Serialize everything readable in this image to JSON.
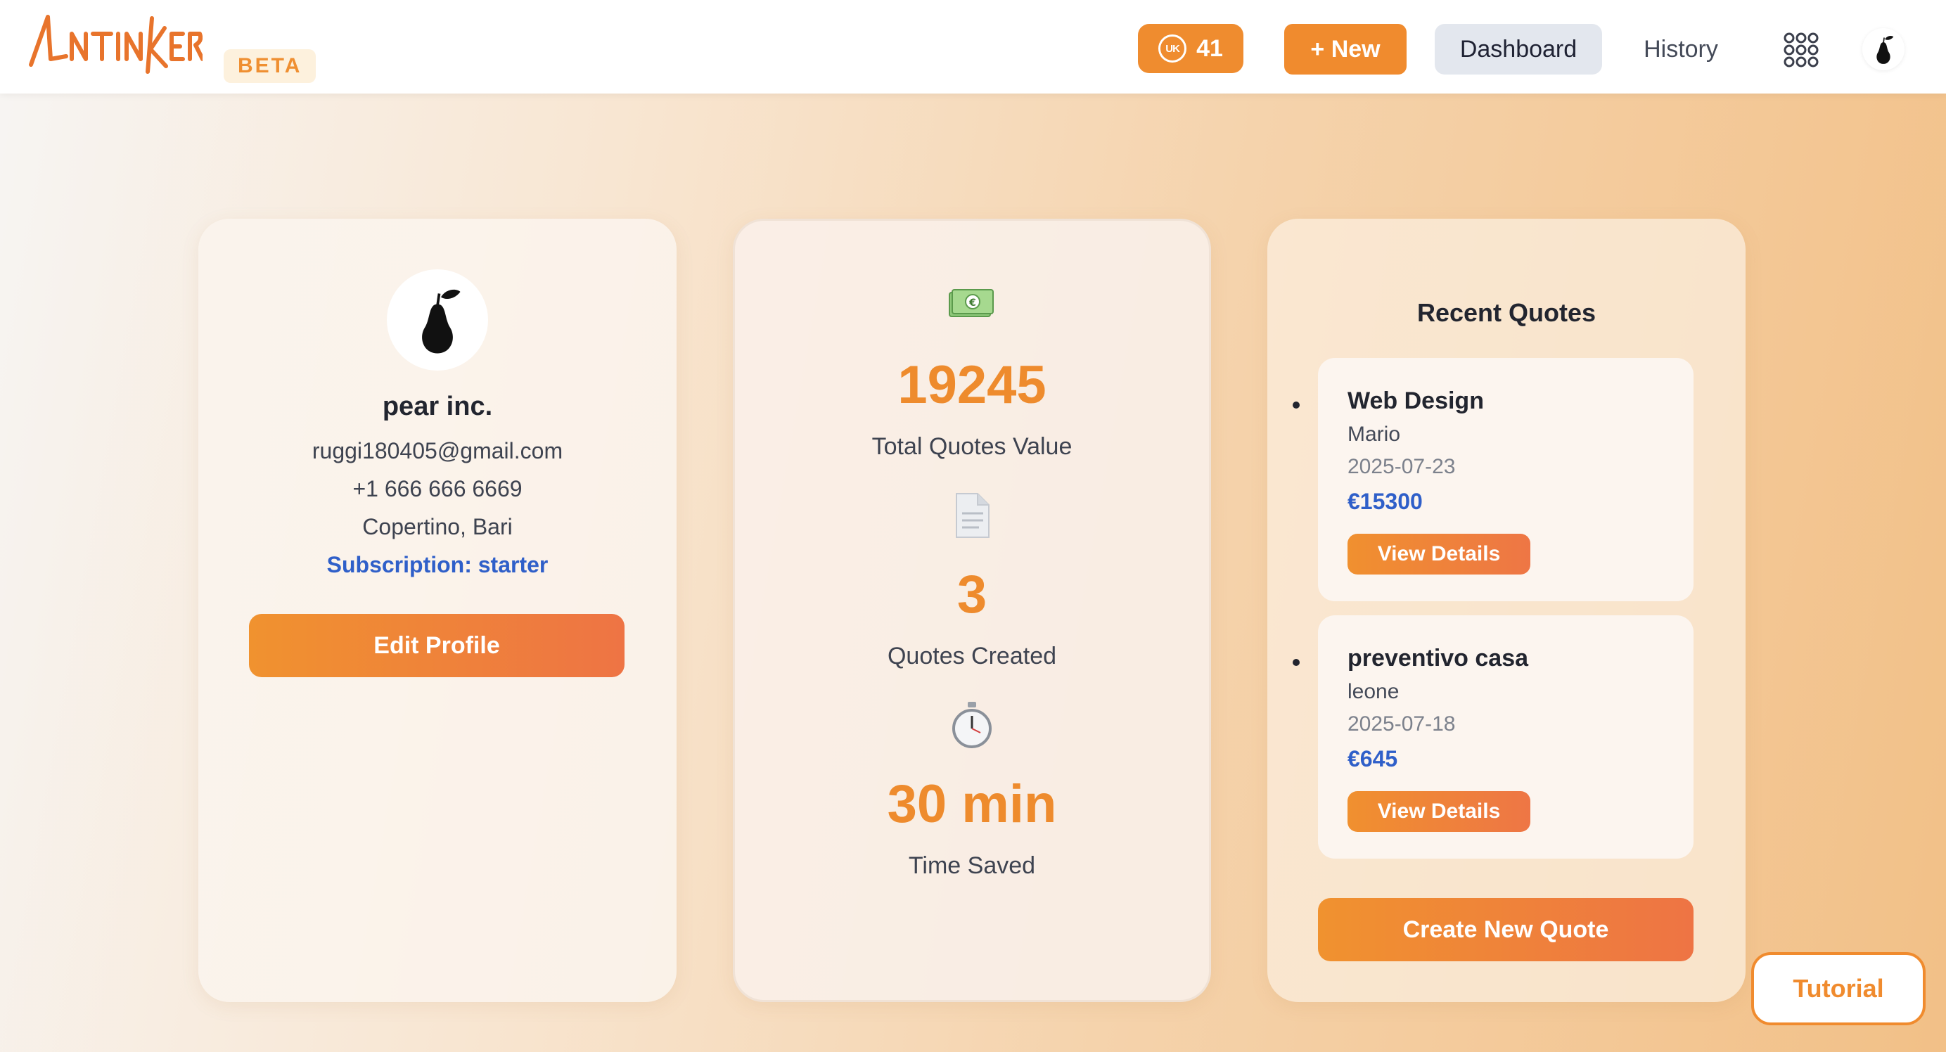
{
  "header": {
    "logo_text": "UNTINKER",
    "beta_label": "BETA",
    "credits": {
      "icon": "coin-icon",
      "icon_text": "UK",
      "value": "41"
    },
    "new_button": "+ New",
    "nav": {
      "dashboard": "Dashboard",
      "history": "History"
    },
    "apps_icon": "apps-grid-icon",
    "user_icon": "pear-icon"
  },
  "profile": {
    "avatar_icon": "pear-icon",
    "name": "pear inc.",
    "email": "ruggi180405@gmail.com",
    "phone": "+1 666 666 6669",
    "location": "Copertino, Bari",
    "subscription": "Subscription: starter",
    "edit_button": "Edit Profile"
  },
  "stats": [
    {
      "icon": "money-icon",
      "value": "19245",
      "label": "Total Quotes Value"
    },
    {
      "icon": "document-icon",
      "value": "3",
      "label": "Quotes Created"
    },
    {
      "icon": "stopwatch-icon",
      "value": "30 min",
      "label": "Time Saved"
    }
  ],
  "recent": {
    "title": "Recent Quotes",
    "quotes": [
      {
        "title": "Web Design",
        "client": "Mario",
        "date": "2025-07-23",
        "amount": "€15300",
        "button": "View Details"
      },
      {
        "title": "preventivo casa",
        "client": "leone",
        "date": "2025-07-18",
        "amount": "€645",
        "button": "View Details"
      }
    ],
    "create_button": "Create New Quote"
  },
  "tutorial_button": "Tutorial",
  "colors": {
    "accent": "#ef8c2f",
    "accent_end": "#ee7444",
    "link_blue": "#2f5fc9",
    "nav_active_bg": "#e3e7ee"
  }
}
